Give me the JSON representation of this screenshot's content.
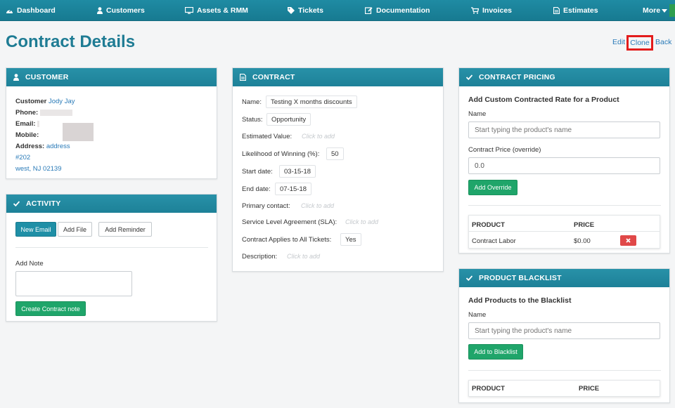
{
  "nav": {
    "items": [
      {
        "label": "Dashboard",
        "icon": "dashboard-icon"
      },
      {
        "label": "Customers",
        "icon": "user-icon"
      },
      {
        "label": "Assets & RMM",
        "icon": "monitor-icon"
      },
      {
        "label": "Tickets",
        "icon": "tag-icon"
      },
      {
        "label": "Documentation",
        "icon": "edit-icon"
      },
      {
        "label": "Invoices",
        "icon": "cart-icon"
      },
      {
        "label": "Estimates",
        "icon": "file-icon"
      },
      {
        "label": "More",
        "icon": "caret-down-icon"
      }
    ]
  },
  "page": {
    "title": "Contract Details",
    "links": {
      "edit": "Edit",
      "clone": "Clone",
      "back": "Back"
    },
    "highlight_color": "#e31c1c"
  },
  "customer": {
    "header": "CUSTOMER",
    "customer_label": "Customer",
    "customer_name": "Jody Jay",
    "phone_label": "Phone:",
    "email_label": "Email:",
    "mobile_label": "Mobile:",
    "address_label": "Address:",
    "address_line1": "address",
    "address_line2": "#202",
    "address_line3": "west, NJ 02139"
  },
  "activity": {
    "header": "ACTIVITY",
    "new_email": "New Email",
    "add_file": "Add File",
    "add_reminder": "Add Reminder",
    "add_note_label": "Add Note",
    "create_note": "Create Contract note"
  },
  "contract": {
    "header": "CONTRACT",
    "name_label": "Name:",
    "name_value": "Testing X months discounts",
    "status_label": "Status:",
    "status_value": "Opportunity",
    "est_value_label": "Estimated Value:",
    "likelihood_label": "Likelihood of Winning (%):",
    "likelihood_value": "50",
    "start_label": "Start date:",
    "start_value": "03-15-18",
    "end_label": "End date:",
    "end_value": "07-15-18",
    "primary_label": "Primary contact:",
    "sla_label": "Service Level Agreement (SLA):",
    "applies_label": "Contract Applies to All Tickets:",
    "applies_value": "Yes",
    "description_label": "Description:",
    "click_to_add": "Click to add"
  },
  "pricing": {
    "header": "CONTRACT PRICING",
    "subheader": "Add Custom Contracted Rate for a Product",
    "name_label": "Name",
    "name_placeholder": "Start typing the product's name",
    "price_label": "Contract Price (override)",
    "price_value": "0.0",
    "add_override": "Add Override",
    "table": {
      "columns": [
        "PRODUCT",
        "PRICE"
      ],
      "rows": [
        {
          "product": "Contract Labor",
          "price": "$0.00"
        }
      ]
    }
  },
  "blacklist": {
    "header": "PRODUCT BLACKLIST",
    "subheader": "Add Products to the Blacklist",
    "name_label": "Name",
    "name_placeholder": "Start typing the product's name",
    "add_button": "Add to Blacklist",
    "table": {
      "columns": [
        "PRODUCT",
        "PRICE"
      ]
    }
  }
}
